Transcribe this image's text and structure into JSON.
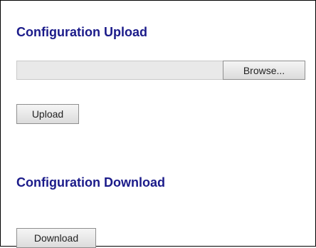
{
  "upload": {
    "title": "Configuration Upload",
    "file_path": "",
    "browse_label": "Browse...",
    "upload_label": "Upload"
  },
  "download": {
    "title": "Configuration Download",
    "download_label": "Download"
  }
}
